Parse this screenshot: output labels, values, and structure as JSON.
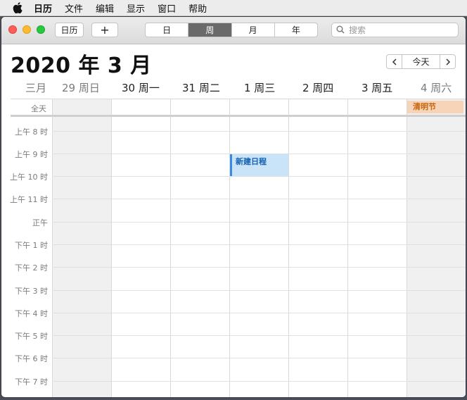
{
  "menubar": {
    "items": [
      "日历",
      "文件",
      "编辑",
      "显示",
      "窗口",
      "帮助"
    ]
  },
  "toolbar": {
    "calendars_label": "日历",
    "add_label": "+",
    "views": [
      "日",
      "周",
      "月",
      "年"
    ],
    "active_view": "周",
    "search_placeholder": "搜索"
  },
  "header": {
    "month_title": "2020 年 3 月",
    "today_label": "今天",
    "prev_label": "‹",
    "next_label": "›"
  },
  "days": {
    "month_label": "三月",
    "labels": [
      "29 周日",
      "30 周一",
      "31 周二",
      "1 周三",
      "2 周四",
      "3 周五",
      "4 周六"
    ]
  },
  "allday_label": "全天",
  "hours": [
    "上午 8 时",
    "上午 9 时",
    "上午 10 时",
    "上午 11 时",
    "正午",
    "下午 1 时",
    "下午 2 时",
    "下午 3 时",
    "下午 4 时",
    "下午 5 时",
    "下午 6 时",
    "下午 7 时"
  ],
  "events": {
    "holiday": "清明节",
    "new_event": "新建日程"
  },
  "colors": {
    "active_segment": "#6a6a6a",
    "holiday_bg": "#f7d4b8",
    "holiday_text": "#c8650f",
    "event_bg": "#c9e3f8",
    "event_accent": "#3a8be0"
  }
}
